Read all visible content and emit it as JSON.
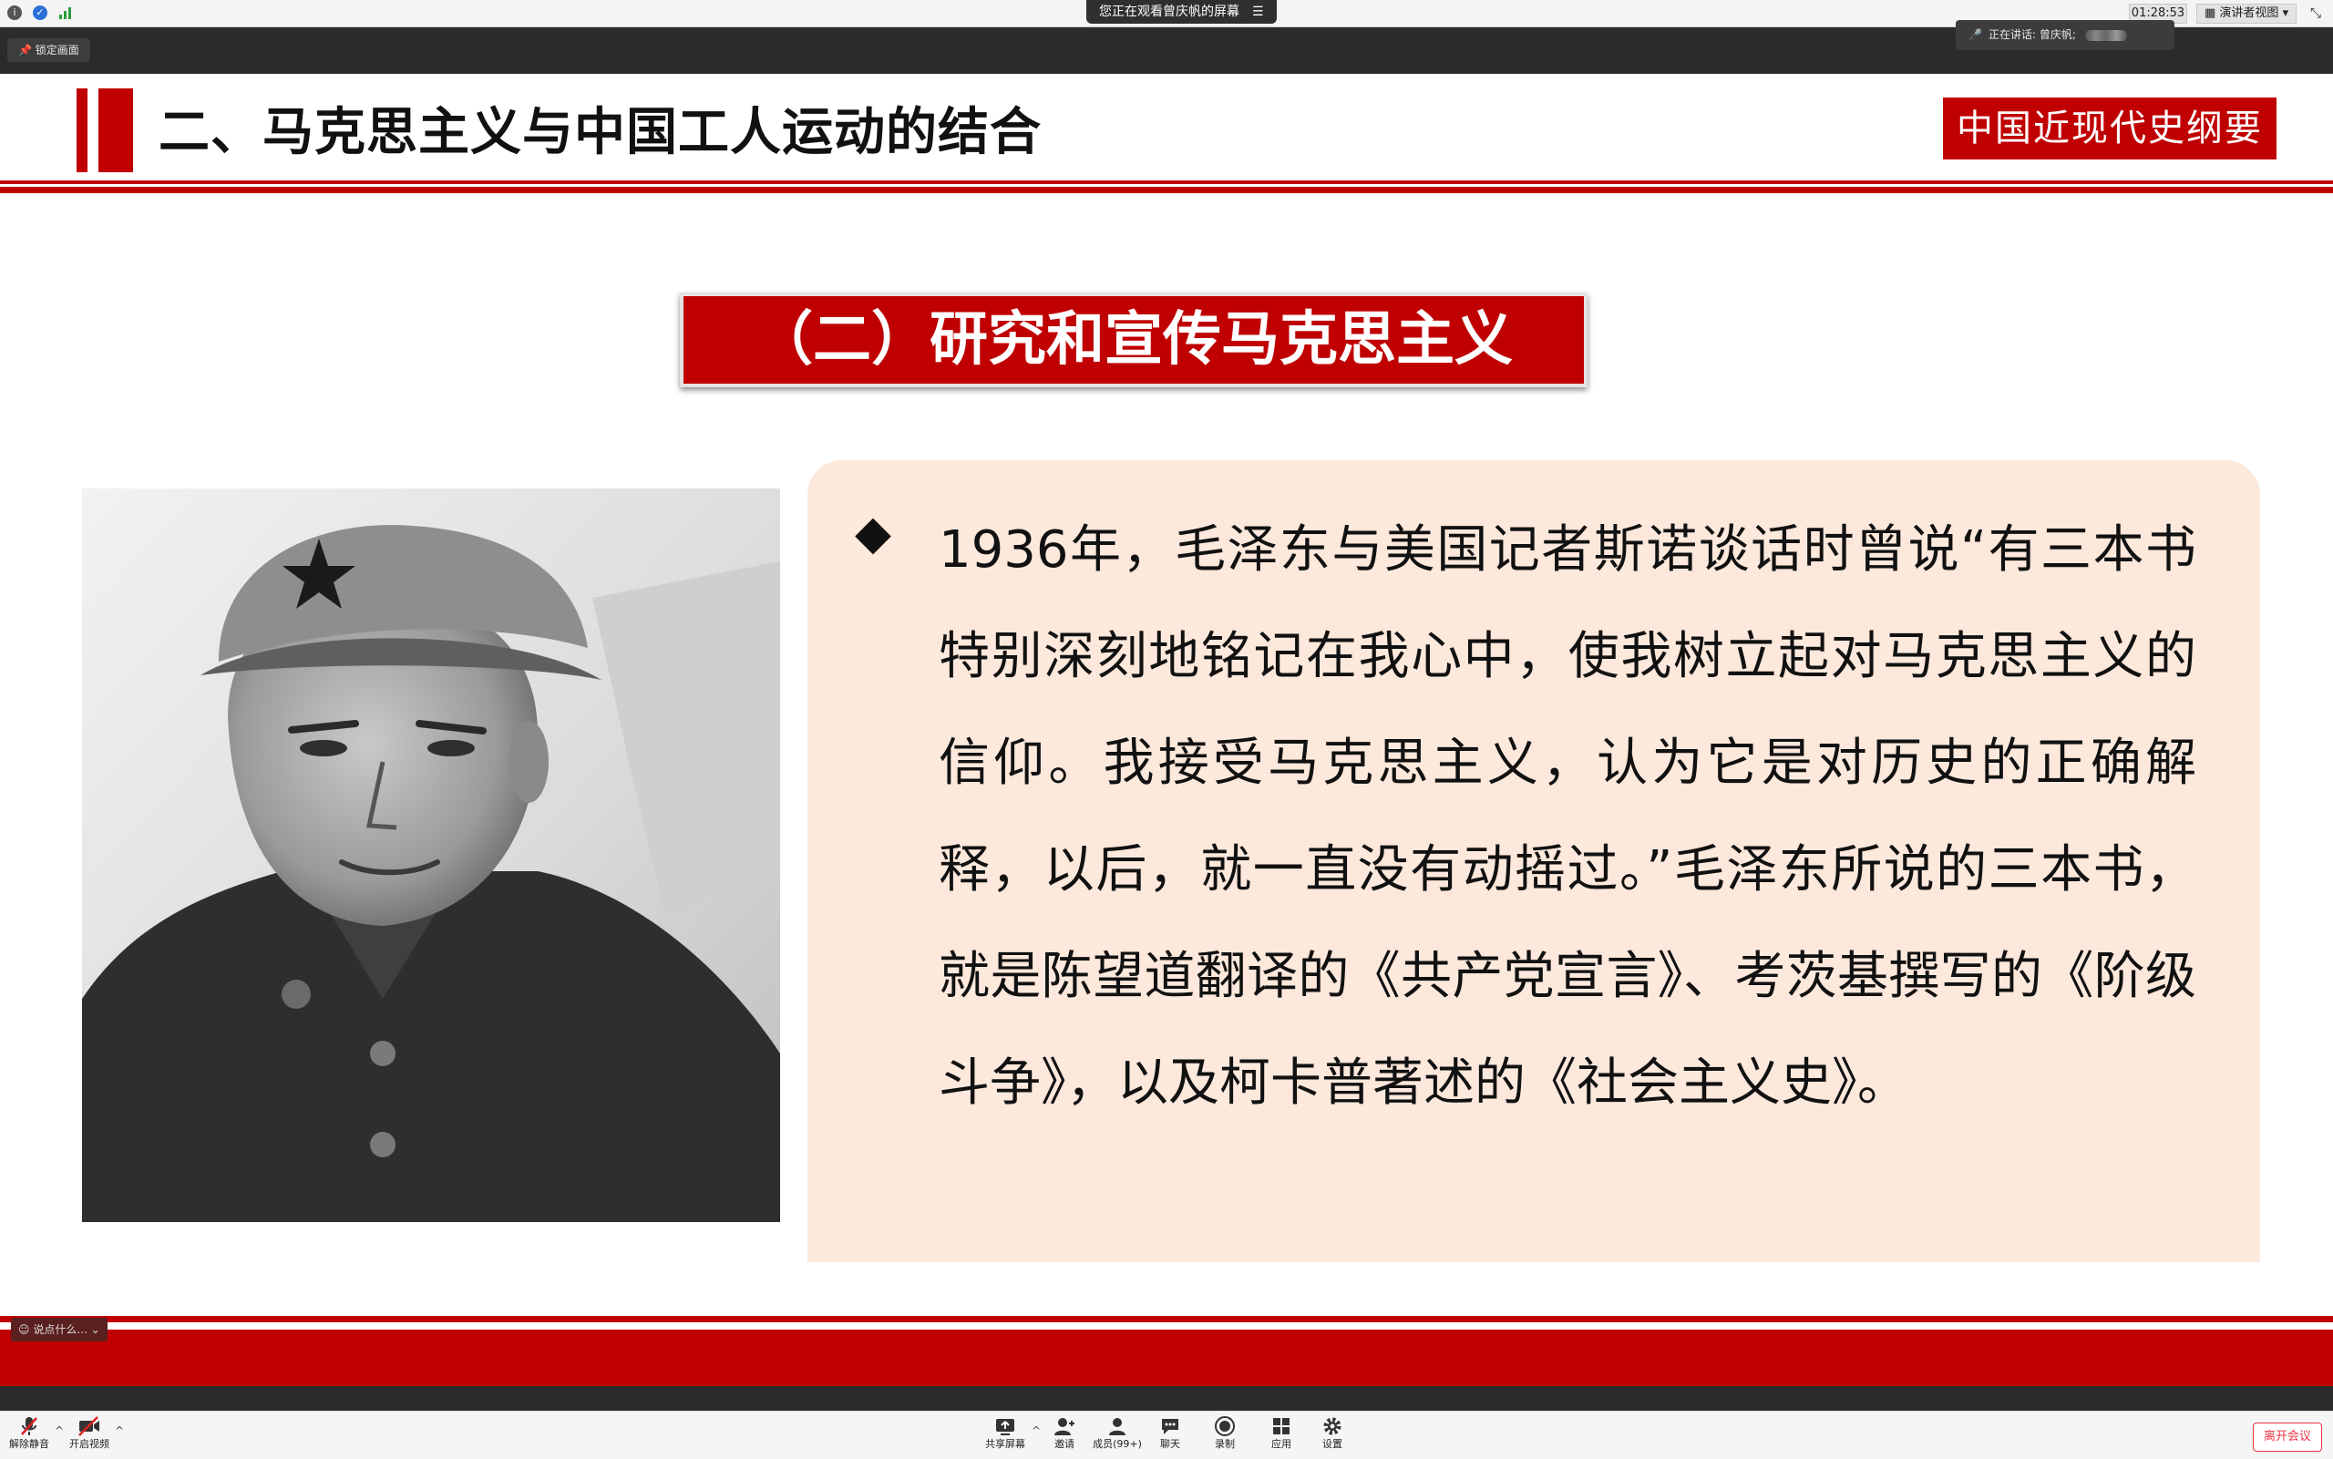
{
  "topbar": {
    "share_status": "您正在观看曾庆帆的屏幕",
    "timer": "01:28:53",
    "view_mode": "演讲者视图"
  },
  "meeting_header": {
    "lock_label": "锁定画面",
    "speaking_label": "正在讲话: 曾庆帆;"
  },
  "slide": {
    "title": "二、马克思主义与中国工人运动的结合",
    "course_tag": "中国近现代史纲要",
    "section_title": "（二）研究和宣传马克思主义",
    "bullet": "◆",
    "quote": "1936年，毛泽东与美国记者斯诺谈话时曾说“有三本书特别深刻地铭记在我心中，使我树立起对马克思主义的信仰。我接受马克思主义，认为它是对历史的正确解释，以后，就一直没有动摇过。”毛泽东所说的三本书，就是陈望道翻译的《共产党宣言》、考茨基撰写的《阶级斗争》，以及柯卡普著述的《社会主义史》。"
  },
  "chat_chip": {
    "placeholder": "说点什么..."
  },
  "toolbar": {
    "mute": "解除静音",
    "video": "开启视频",
    "share": "共享屏幕",
    "invite": "邀请",
    "members": "成员(99+)",
    "chat": "聊天",
    "record": "录制",
    "apps": "应用",
    "settings": "设置",
    "leave": "离开会议"
  },
  "colors": {
    "accent_red": "#c00000",
    "quote_bg": "#fde8dc",
    "dark_bar": "#2b2b2b"
  }
}
